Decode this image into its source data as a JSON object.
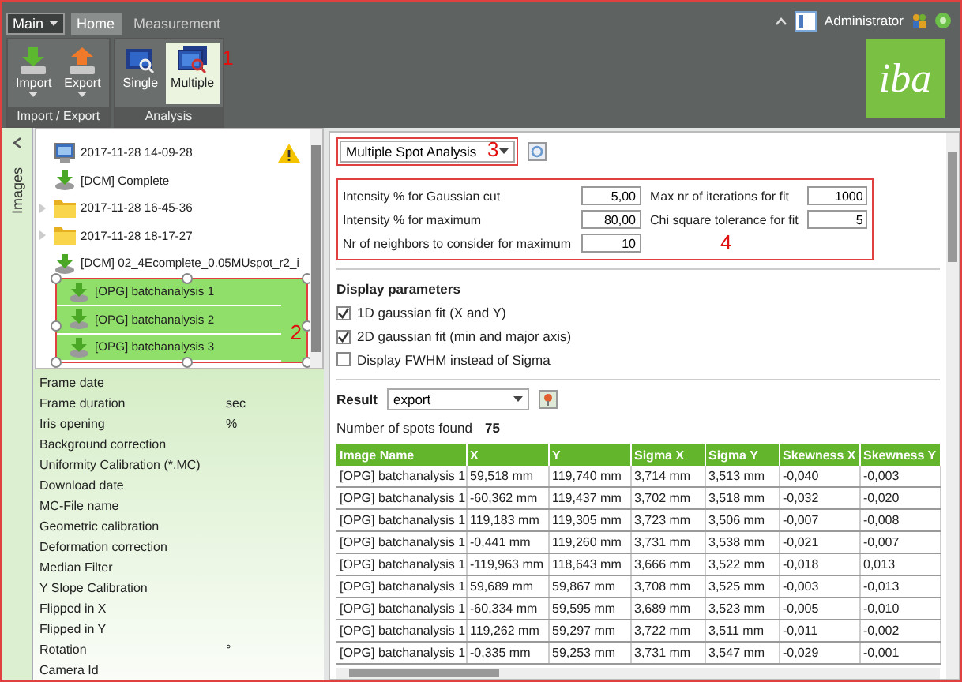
{
  "ribbon": {
    "menu": "Main",
    "tabs": [
      {
        "label": "Home",
        "selected": true
      },
      {
        "label": "Measurement",
        "selected": false
      }
    ],
    "groups": [
      {
        "label": "Import / Export",
        "buttons": [
          {
            "label": "Import",
            "kind": "import",
            "selected": false,
            "dropdown": true
          },
          {
            "label": "Export",
            "kind": "export",
            "selected": false,
            "dropdown": true
          }
        ]
      },
      {
        "label": "Analysis",
        "buttons": [
          {
            "label": "Single",
            "kind": "single",
            "selected": false,
            "dropdown": false
          },
          {
            "label": "Multiple",
            "kind": "multiple",
            "selected": true,
            "dropdown": false,
            "annotation": "1"
          }
        ]
      }
    ],
    "user": "Administrator",
    "logo": "iba"
  },
  "side_tab": {
    "label": "Images"
  },
  "tree": {
    "annotation": "2",
    "items": [
      {
        "label": "2017-11-28 14-09-28",
        "kind": "scan",
        "selected": false,
        "warning": true
      },
      {
        "label": "[DCM] Complete",
        "kind": "download",
        "selected": false,
        "warning": false
      },
      {
        "label": "2017-11-28 16-45-36",
        "kind": "folder",
        "selected": false,
        "warning": false,
        "expanded": false
      },
      {
        "label": "2017-11-28 18-17-27",
        "kind": "folder",
        "selected": false,
        "warning": false,
        "expanded": false
      },
      {
        "label": "[DCM] 02_4Ecomplete_0.05MUspot_r2_i",
        "kind": "download",
        "selected": false,
        "warning": false
      },
      {
        "label": "[OPG] batchanalysis 1",
        "kind": "download",
        "selected": true,
        "warning": false
      },
      {
        "label": "[OPG] batchanalysis 2",
        "kind": "download",
        "selected": true,
        "warning": false
      },
      {
        "label": "[OPG] batchanalysis 3",
        "kind": "download",
        "selected": true,
        "warning": false
      }
    ]
  },
  "properties": [
    {
      "label": "Frame date"
    },
    {
      "label": "Frame duration",
      "value": "sec"
    },
    {
      "label": "Iris opening",
      "value": "%"
    },
    {
      "label": "Background correction"
    },
    {
      "label": "Uniformity Calibration (*.MC)"
    },
    {
      "label": "Download date"
    },
    {
      "label": "MC-File name"
    },
    {
      "label": "Geometric calibration"
    },
    {
      "label": "Deformation correction"
    },
    {
      "label": "Median Filter"
    },
    {
      "label": "Y Slope Calibration"
    },
    {
      "label": "Flipped in X"
    },
    {
      "label": "Flipped in Y"
    },
    {
      "label": "Rotation",
      "value": "°"
    },
    {
      "label": "Camera Id"
    }
  ],
  "analysis": {
    "mode": "Multiple Spot Analysis",
    "annotation": "3"
  },
  "parameters": {
    "annotation": "4",
    "fields": [
      {
        "label": "Intensity % for Gaussian cut",
        "value": "5,00"
      },
      {
        "label": "Max nr of iterations for fit",
        "value": "1000"
      },
      {
        "label": "Intensity % for maximum",
        "value": "80,00"
      },
      {
        "label": "Chi square tolerance for fit",
        "value": "5"
      },
      {
        "label": "Nr of neighbors to consider for maximum",
        "value": "10"
      }
    ]
  },
  "display": {
    "title": "Display parameters",
    "options": [
      {
        "label": "1D gaussian fit (X and Y)",
        "checked": true
      },
      {
        "label": "2D gaussian fit (min and major axis)",
        "checked": true
      },
      {
        "label": "Display FWHM instead of Sigma",
        "checked": false
      }
    ]
  },
  "result": {
    "label": "Result",
    "value": "export"
  },
  "spots": {
    "label": "Number of spots found",
    "value": "75"
  },
  "table": {
    "columns": [
      "Image Name",
      "X",
      "Y",
      "Sigma X",
      "Sigma Y",
      "Skewness X",
      "Skewness Y"
    ],
    "rows": [
      [
        "[OPG] batchanalysis 1",
        "59,518 mm",
        "119,740 mm",
        "3,714 mm",
        "3,513 mm",
        "-0,040",
        "-0,003"
      ],
      [
        "[OPG] batchanalysis 1",
        "-60,362 mm",
        "119,437 mm",
        "3,702 mm",
        "3,518 mm",
        "-0,032",
        "-0,020"
      ],
      [
        "[OPG] batchanalysis 1",
        "119,183 mm",
        "119,305 mm",
        "3,723 mm",
        "3,506 mm",
        "-0,007",
        "-0,008"
      ],
      [
        "[OPG] batchanalysis 1",
        "-0,441 mm",
        "119,260 mm",
        "3,731 mm",
        "3,538 mm",
        "-0,021",
        "-0,007"
      ],
      [
        "[OPG] batchanalysis 1",
        "-119,963 mm",
        "118,643 mm",
        "3,666 mm",
        "3,522 mm",
        "-0,018",
        "0,013"
      ],
      [
        "[OPG] batchanalysis 1",
        "59,689 mm",
        "59,867 mm",
        "3,708 mm",
        "3,525 mm",
        "-0,003",
        "-0,013"
      ],
      [
        "[OPG] batchanalysis 1",
        "-60,334 mm",
        "59,595 mm",
        "3,689 mm",
        "3,523 mm",
        "-0,005",
        "-0,010"
      ],
      [
        "[OPG] batchanalysis 1",
        "119,262 mm",
        "59,297 mm",
        "3,722 mm",
        "3,511 mm",
        "-0,011",
        "-0,002"
      ],
      [
        "[OPG] batchanalysis 1",
        "-0,335 mm",
        "59,253 mm",
        "3,731 mm",
        "3,547 mm",
        "-0,029",
        "-0,001"
      ]
    ]
  }
}
